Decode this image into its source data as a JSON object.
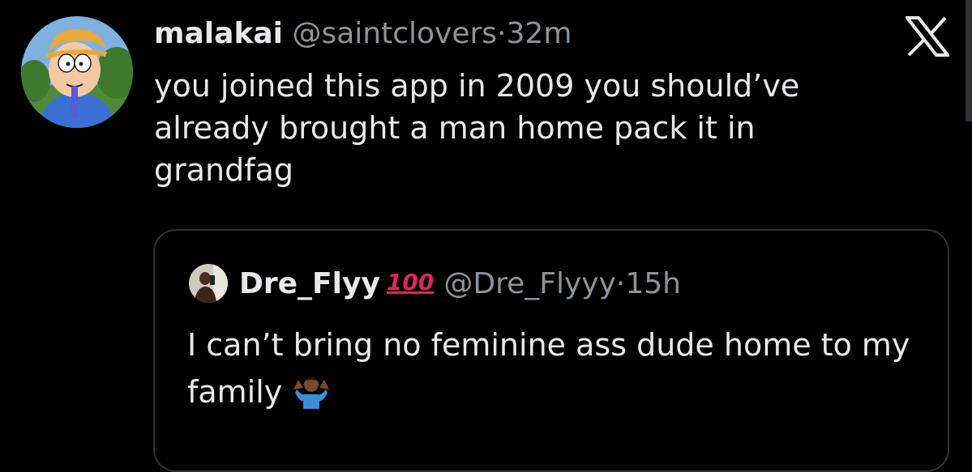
{
  "tweet": {
    "display_name": "malakai",
    "handle": "@saintclovers",
    "separator": "·",
    "time": "32m",
    "text": "you joined this app in 2009 you should’ve already brought a man home pack it in grandfag",
    "avatar_icon": "cartoon-avatar-icon"
  },
  "quoted_tweet": {
    "display_name": "Dre_Flyy",
    "badge_emoji": "100",
    "handle": "@Dre_Flyyy",
    "separator": "·",
    "time": "15h",
    "text": "I can’t bring no feminine ass dude home to my family",
    "trailing_emoji_icon": "person-shrugging-icon"
  },
  "brand": {
    "logo": "x-logo-icon"
  },
  "colors": {
    "background": "#000000",
    "primary_text": "#e7e9ea",
    "secondary_text": "#8b949b",
    "border": "#2f3336",
    "emoji_red": "#e0245e"
  }
}
